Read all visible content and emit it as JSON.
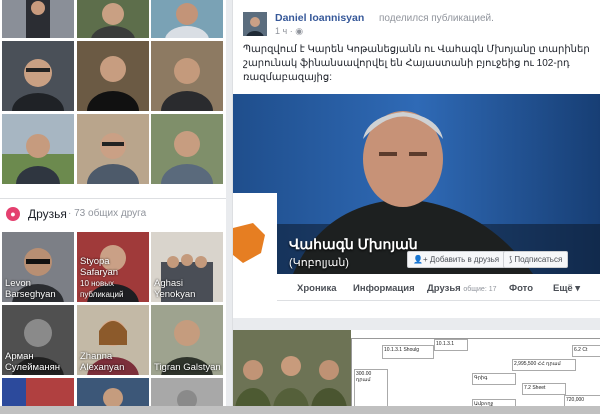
{
  "friends_header": {
    "icon": "friends-icon",
    "title": "Друзья",
    "count": "· 73 общих друга"
  },
  "friends": [
    {
      "name": "Levon Barseghyan",
      "sub": ""
    },
    {
      "name": "Styopa Safaryan",
      "sub": "10 новых публикаций"
    },
    {
      "name": "Aghasi Yenokyan",
      "sub": ""
    },
    {
      "name": "Арман Сулейманян",
      "sub": ""
    },
    {
      "name": "Zhanna Alexanyan",
      "sub": ""
    },
    {
      "name": "Tigran Galstyan",
      "sub": ""
    }
  ],
  "post": {
    "author": "Daniel Ioannisyan",
    "shared_text": "поделился публикацией.",
    "time": "1 ч",
    "text_lines": [
      "Պարզվում է Կարեն Կոթանեցյանն ու Վահագն Մխոյանը տարիներ",
      "շարունակ ֆինանսավորվել են Հայաստանի բյուջեից ու 102-րդ",
      "ռազմաբազայից:"
    ]
  },
  "page": {
    "name": "Վահագն Մխոյան",
    "subtitle": "(Կոբոլյան)",
    "add_friend_label": "Добавить в друзья",
    "subscribe_label": "Подписаться",
    "tabs": [
      {
        "label": "Хроника",
        "extra": ""
      },
      {
        "label": "Информация",
        "extra": ""
      },
      {
        "label": "Друзья",
        "extra": "общие: 17"
      },
      {
        "label": "Фото",
        "extra": ""
      },
      {
        "label": "Ещё ▾",
        "extra": ""
      }
    ]
  },
  "doc": {
    "cells": [
      "10.1.3.1 Shoulg",
      "10.1.3.1",
      "2,995,500 ՀՀ դրամ",
      "6.2 Ct",
      "7.2 Sheet",
      "720,000",
      "300.00 դրամ",
      "Գրիգ",
      "Ամբողջ"
    ]
  }
}
